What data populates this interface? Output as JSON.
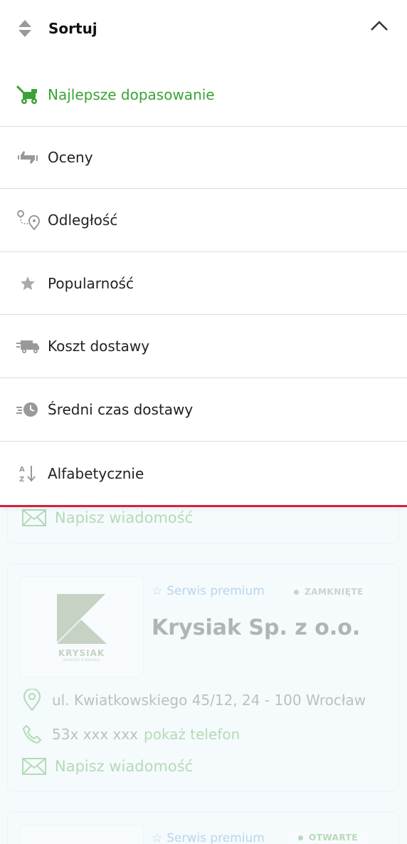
{
  "sort": {
    "title": "Sortuj",
    "options": [
      {
        "label": "Najlepsze dopasowanie",
        "icon": "lawnmower-icon",
        "active": true
      },
      {
        "label": "Oceny",
        "icon": "thumbs-icon"
      },
      {
        "label": "Odległość",
        "icon": "route-pin-icon"
      },
      {
        "label": "Popularność",
        "icon": "star-icon"
      },
      {
        "label": "Koszt dostawy",
        "icon": "truck-icon"
      },
      {
        "label": "Średni czas dostawy",
        "icon": "clock-fast-icon"
      },
      {
        "label": "Alfabetycznie",
        "icon": "sort-az-icon"
      }
    ]
  },
  "listing": {
    "card1": {
      "message": "Napisz wiadomość"
    },
    "card2": {
      "premium": "Serwis premium",
      "status": "ZAMKNIĘTE",
      "name": "Krysiak Sp. z o.o.",
      "logo_text": "KRYSIAK",
      "logo_sub": "SKUTECZNY W KONCEPCJI",
      "address": "ul. Kwiatkowskiego 45/12, 24 - 100 Wrocław",
      "phone": "53x xxx xxx",
      "show_phone": "pokaż telefon",
      "message": "Napisz wiadomość"
    },
    "card3": {
      "premium": "Serwis premium",
      "status": "OTWARTE"
    }
  },
  "colors": {
    "accent": "#3aa335",
    "underline": "#d6213b"
  }
}
